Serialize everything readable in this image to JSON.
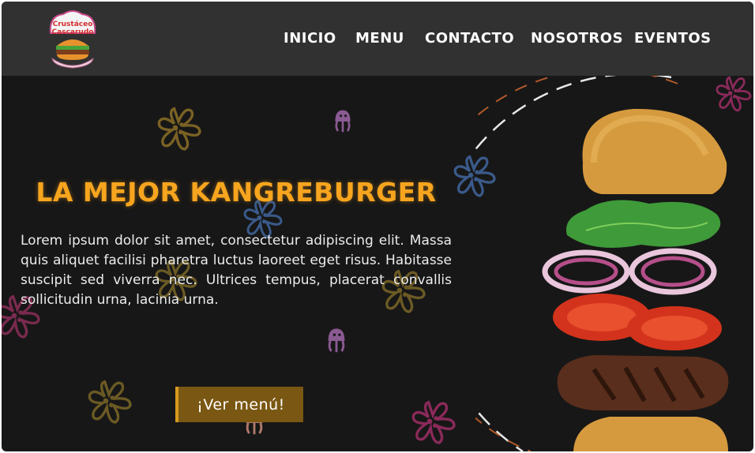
{
  "brand": {
    "logo_line1": "Crustáceo",
    "logo_line2": "Cascarudo"
  },
  "nav": {
    "items": [
      {
        "label": "INICIO"
      },
      {
        "label": "MENU"
      },
      {
        "label": "CONTACTO"
      },
      {
        "label": "NOSOTROS"
      },
      {
        "label": "EVENTOS"
      }
    ]
  },
  "hero": {
    "title": "LA MEJOR KANGREBURGER",
    "description": "Lorem ipsum dolor sit amet, consectetur adipiscing elit. Massa quis aliquet facilisi pharetra luctus laoreet eget risus. Habitasse suscipit sed viverra nec. Ultrices tempus, placerat convallis sollicitudin urna, lacinia urna.",
    "cta_label": "¡Ver menú!"
  },
  "colors": {
    "navbar_bg": "#313131",
    "page_bg": "#171717",
    "title": "#f7a51e",
    "cta_bg": "#7a5712",
    "cta_accent": "#d79a1e"
  },
  "icons": [
    "burger-logo-icon",
    "flower-decoration-icon",
    "jellyfish-decoration-icon",
    "burger-illustration"
  ]
}
